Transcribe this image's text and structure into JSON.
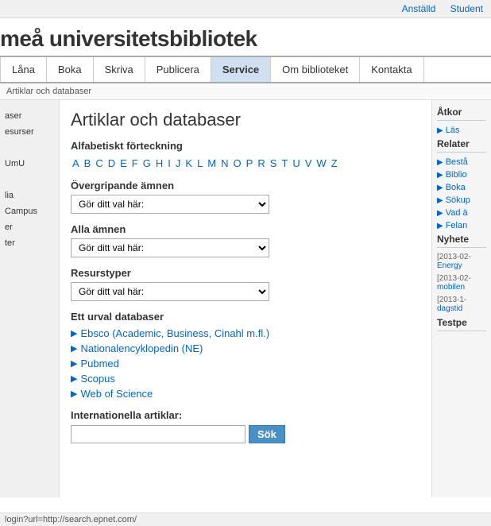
{
  "topbar": {
    "links": [
      "Anställd",
      "Student"
    ]
  },
  "header": {
    "title": "meå universitetsbibliotek"
  },
  "nav": {
    "items": [
      {
        "label": "Låna",
        "active": false
      },
      {
        "label": "Boka",
        "active": false
      },
      {
        "label": "Skriva",
        "active": false
      },
      {
        "label": "Publicera",
        "active": false
      },
      {
        "label": "Service",
        "active": true
      },
      {
        "label": "Om biblioteket",
        "active": false
      },
      {
        "label": "Kontakta",
        "active": false
      }
    ]
  },
  "breadcrumb": {
    "text": "Artiklar och databaser"
  },
  "page": {
    "title": "Artiklar och databaser",
    "alphabet_label": "Alfabetiskt förteckning",
    "letters": [
      "A",
      "B",
      "C",
      "D",
      "E",
      "F",
      "G",
      "H",
      "I",
      "J",
      "K",
      "L",
      "M",
      "N",
      "O",
      "P",
      "R",
      "S",
      "T",
      "U",
      "V",
      "W",
      "Z"
    ],
    "overarching_label": "Övergripande ämnen",
    "overarching_placeholder": "Gör ditt val här:",
    "all_subjects_label": "Alla ämnen",
    "all_subjects_placeholder": "Gör ditt val här:",
    "resource_types_label": "Resurstyper",
    "resource_types_placeholder": "Gör ditt val här:",
    "db_section_label": "Ett urval databaser",
    "databases": [
      {
        "name": "Ebsco (Academic, Business, Cinahl m.fl.)",
        "url": "#"
      },
      {
        "name": "Nationalencyklopedin (NE)",
        "url": "#"
      },
      {
        "name": "Pubmed",
        "url": "#"
      },
      {
        "name": "Scopus",
        "url": "#"
      },
      {
        "name": "Web of Science",
        "url": "#"
      }
    ],
    "intl_label": "Internationella artiklar:",
    "search_placeholder": "",
    "search_button": "Sök"
  },
  "sidebar": {
    "items": [
      {
        "label": "aser"
      },
      {
        "label": "esurser"
      },
      {
        "label": ""
      },
      {
        "label": "UmU"
      },
      {
        "label": ""
      },
      {
        "label": "lia"
      },
      {
        "label": "Campus"
      },
      {
        "label": "er"
      },
      {
        "label": "ter"
      }
    ]
  },
  "right_sidebar": {
    "section1_title": "Åtkor",
    "link1": "Läs",
    "section2_title": "Relater",
    "links": [
      "Bestå",
      "Biblio",
      "Boka",
      "Sökup",
      "Vad ä",
      "Felan"
    ],
    "section3_title": "Nyhete",
    "news": [
      {
        "date": "[2013-02-",
        "text": "Energy",
        "full": "[2013-02-"
      },
      {
        "date": "[2013-02-",
        "text": "mobilen",
        "full": "[2013-02-"
      },
      {
        "date": "[2013-1-",
        "text": "dagstid",
        "full": "[2013-1-"
      }
    ],
    "section4_title": "Testpe"
  },
  "statusbar": {
    "text": "login?url=http://search.epnet.com/"
  }
}
